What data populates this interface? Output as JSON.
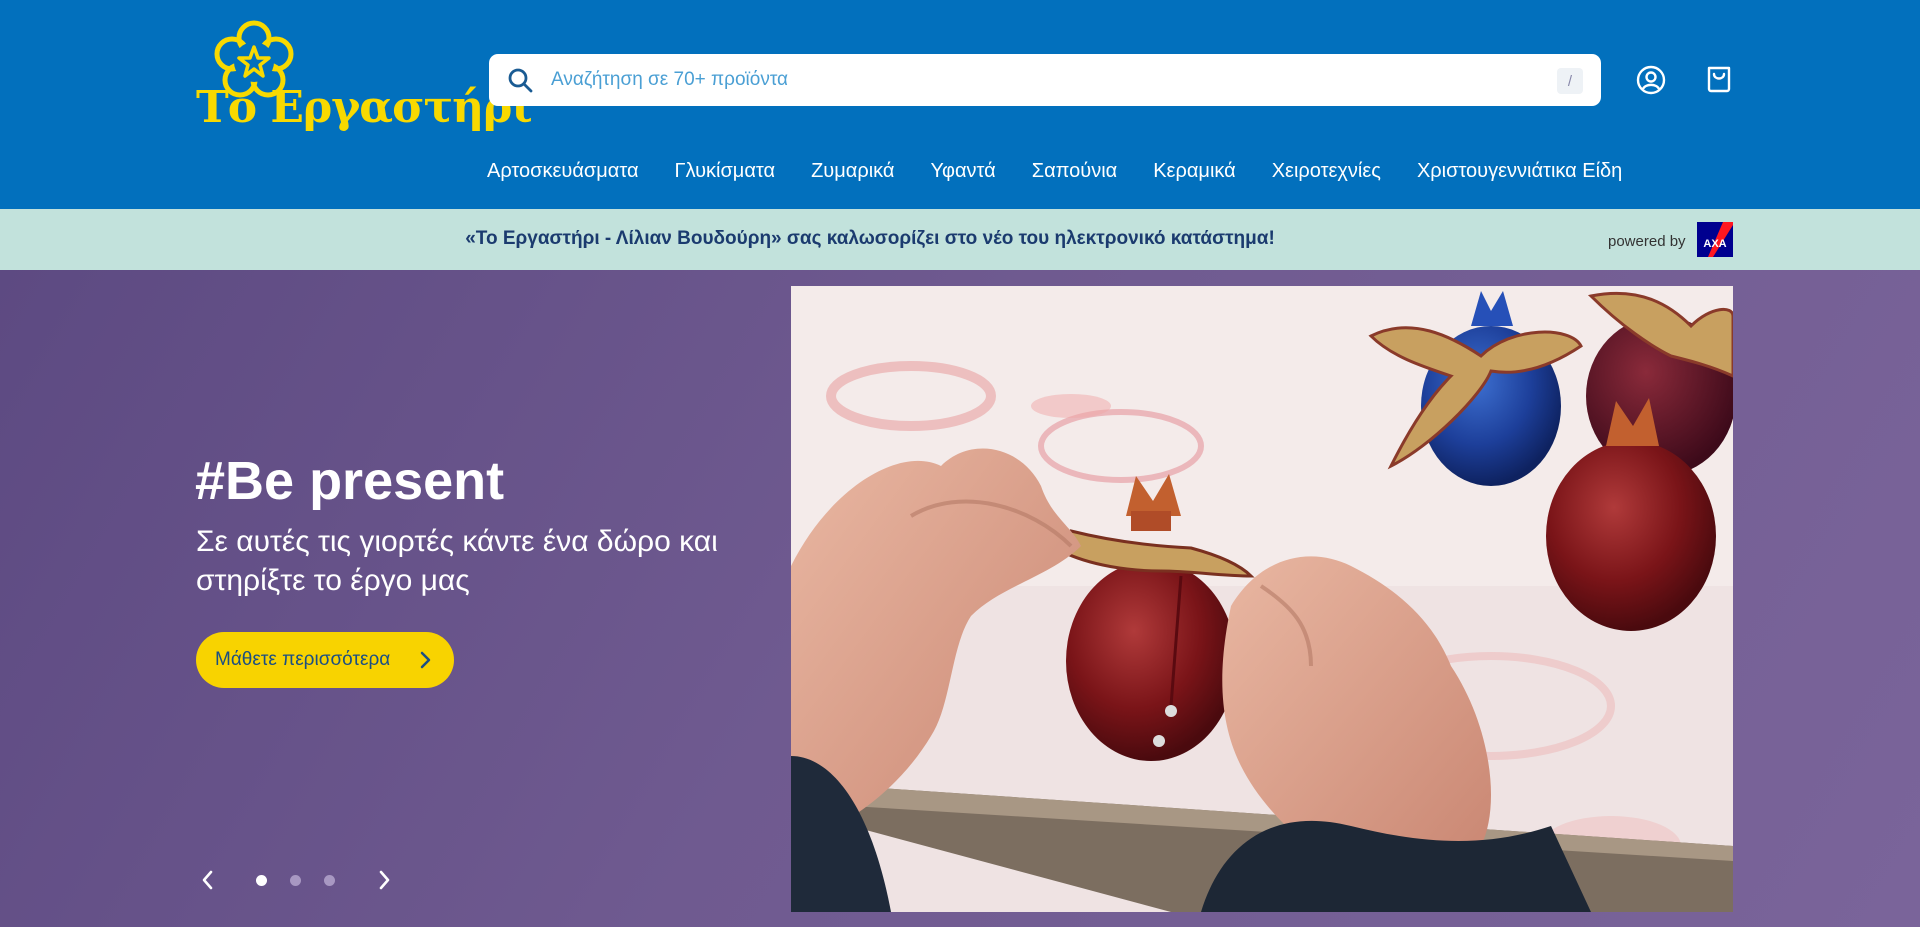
{
  "brand": {
    "logo_text": "Το Εργαστήρι",
    "logo_color": "#f8d900",
    "header_color": "#0270bd"
  },
  "search": {
    "placeholder": "Αναζήτηση σε 70+ προϊόντα",
    "shortcut_key": "/"
  },
  "header_icons": [
    "account-icon",
    "cart-icon"
  ],
  "nav": {
    "items": [
      "Αρτοσκευάσματα",
      "Γλυκίσματα",
      "Ζυμαρικά",
      "Υφαντά",
      "Σαπούνια",
      "Κεραμικά",
      "Χειροτεχνίες",
      "Χριστουγεννιάτικα Είδη"
    ]
  },
  "announcement": {
    "text": "«Το Εργαστήρι - Λίλιαν Βουδούρη» σας καλωσορίζει στο νέο του ηλεκτρονικό κατάστημα!",
    "powered_by": "powered by",
    "partner_logo_text": "AXA"
  },
  "hero": {
    "title": "#Be present",
    "subtitle": "Σε αυτές τις γιορτές κάντε ένα δώρο και στηρίξτε το έργο μας",
    "cta_label": "Μάθετε περισσότερα",
    "cta_color": "#f8d300",
    "slides_total": 3,
    "active_slide": 1
  }
}
